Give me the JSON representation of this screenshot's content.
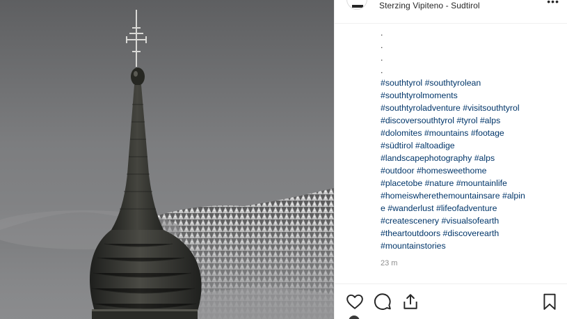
{
  "post": {
    "location": "Sterzing Vipiteno - Sudtirol",
    "caption_dots": [
      ".",
      ".",
      ".",
      "."
    ],
    "caption_hashtags": "#southtyrol #southtyrolean\n#southtyrolmoments\n#southtyroladventure #visitsouthtyrol\n#discoversouthtyrol #tyrol #alps\n#dolomites #mountains #footage\n#südtirol #altoadige\n#landscapephotography #alps\n#outdoor #homesweethome\n#placetobe #nature #mountainlife\n#homeiswherethemountainsare #alpin\ne #wanderlust #lifeofadventure\n#createscenery #visualsofearth\n#theartoutdoors #discoverearth\n#mountainstories",
    "timestamp": "23 m"
  },
  "icons": {
    "like": "heart-icon",
    "comment": "comment-bubble-icon",
    "share": "share-upload-icon",
    "save": "bookmark-icon",
    "more": "more-options-icon"
  },
  "colors": {
    "hashtag": "#003569",
    "text": "#262626",
    "muted": "#8e8e8e",
    "border": "#efefef"
  }
}
